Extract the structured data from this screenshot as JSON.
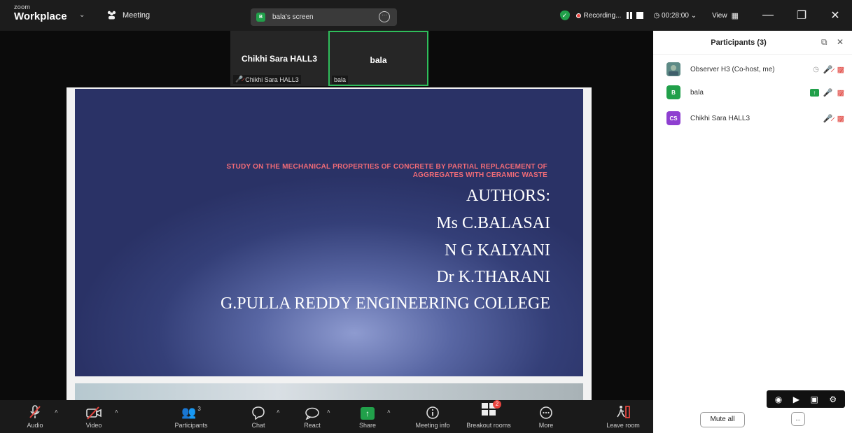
{
  "titlebar": {
    "logo_small": "zoom",
    "logo_big": "Workplace",
    "meeting_label": "Meeting",
    "screen_label": "bala's screen",
    "screen_badge": "B",
    "recording_label": "Recording...",
    "timer": "00:28:00",
    "view_label": "View"
  },
  "thumbnails": [
    {
      "name": "Chikhi Sara HALL3",
      "tag": "Chikhi Sara HALL3"
    },
    {
      "name": "bala",
      "tag": "bala"
    }
  ],
  "slide": {
    "heading_line1": "STUDY ON THE MECHANICAL PROPERTIES OF CONCRETE BY PARTIAL REPLACEMENT OF",
    "heading_line2": "AGGREGATES WITH CERAMIC WASTE",
    "line_authors": "AUTHORS:",
    "line_a1": "Ms C.BALASAI",
    "line_a2": "N G KALYANI",
    "line_a3": "Dr K.THARANI",
    "line_college": "G.PULLA REDDY ENGINEERING COLLEGE"
  },
  "toolbar": {
    "audio": "Audio",
    "video": "Video",
    "participants": "Participants",
    "participants_count": "3",
    "chat": "Chat",
    "react": "React",
    "share": "Share",
    "meeting_info": "Meeting info",
    "breakout": "Breakout rooms",
    "breakout_badge": "2",
    "more": "More",
    "leave": "Leave room"
  },
  "panel": {
    "title": "Participants (3)",
    "participants": [
      {
        "name": "Observer H3 (Co-host, me)",
        "initials": "",
        "color": "#6a8f7a"
      },
      {
        "name": "bala",
        "initials": "B",
        "color": "#21a04a"
      },
      {
        "name": "Chikhi Sara HALL3",
        "initials": "CS",
        "color": "#8e3fd0"
      }
    ],
    "mute_all": "Mute all",
    "more": "..."
  },
  "colors": {
    "accent_green": "#21a04a",
    "muted_red": "#e0443e",
    "slide_heading": "#f06b77"
  }
}
